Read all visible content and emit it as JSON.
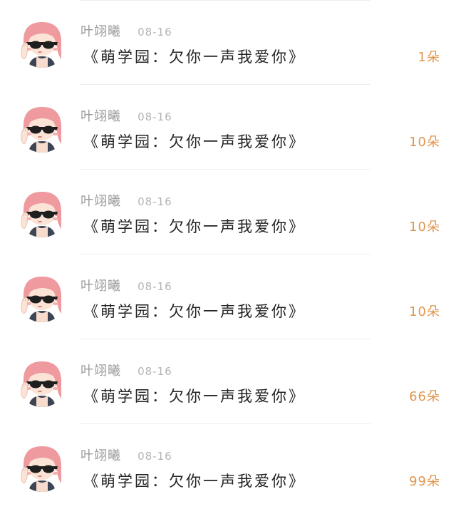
{
  "records": [
    {
      "user": "叶翊曦",
      "date": "08-16",
      "gift": "《萌学园：欠你一声我爱你》",
      "count": "1朵"
    },
    {
      "user": "叶翊曦",
      "date": "08-16",
      "gift": "《萌学园：欠你一声我爱你》",
      "count": "10朵"
    },
    {
      "user": "叶翊曦",
      "date": "08-16",
      "gift": "《萌学园：欠你一声我爱你》",
      "count": "10朵"
    },
    {
      "user": "叶翊曦",
      "date": "08-16",
      "gift": "《萌学园：欠你一声我爱你》",
      "count": "10朵"
    },
    {
      "user": "叶翊曦",
      "date": "08-16",
      "gift": "《萌学园：欠你一声我爱你》",
      "count": "66朵"
    },
    {
      "user": "叶翊曦",
      "date": "08-16",
      "gift": "《萌学园：欠你一声我爱你》",
      "count": "99朵"
    }
  ],
  "colors": {
    "username": "#9a9a9a",
    "date": "#b3b3b3",
    "title": "#222222",
    "count": "#e2954c",
    "divider": "#eeeeee"
  },
  "icons": {
    "avatar": "girl-with-sunglasses-avatar"
  }
}
